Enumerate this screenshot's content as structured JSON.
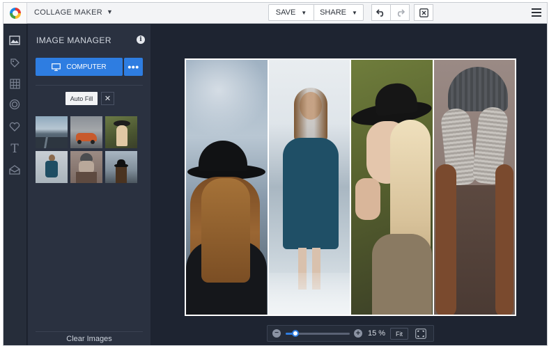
{
  "header": {
    "app_title": "COLLAGE MAKER",
    "save_label": "SAVE",
    "share_label": "SHARE",
    "icons": [
      "undo-icon",
      "redo-icon",
      "close-icon",
      "menu-icon"
    ]
  },
  "rail": {
    "icons": [
      "image-icon",
      "tag-icon",
      "grid-icon",
      "frame-icon",
      "heart-icon",
      "text-icon",
      "overlay-icon"
    ]
  },
  "panel": {
    "title": "IMAGE MANAGER",
    "computer_label": "COMPUTER",
    "more_label": "•••",
    "auto_fill_label": "Auto Fill",
    "clear_label": "Clear Images"
  },
  "thumbnails": [
    {
      "name": "thumb-road"
    },
    {
      "name": "thumb-car"
    },
    {
      "name": "thumb-woman-hat"
    },
    {
      "name": "thumb-woman-sweater"
    },
    {
      "name": "thumb-hands-face"
    },
    {
      "name": "thumb-snow-hat"
    }
  ],
  "zoom": {
    "value_label": "15 %",
    "fit_label": "Fit",
    "level": 0.15
  },
  "colors": {
    "accent": "#2e7de1",
    "panel": "#2a3140",
    "workspace": "#1e2431"
  }
}
